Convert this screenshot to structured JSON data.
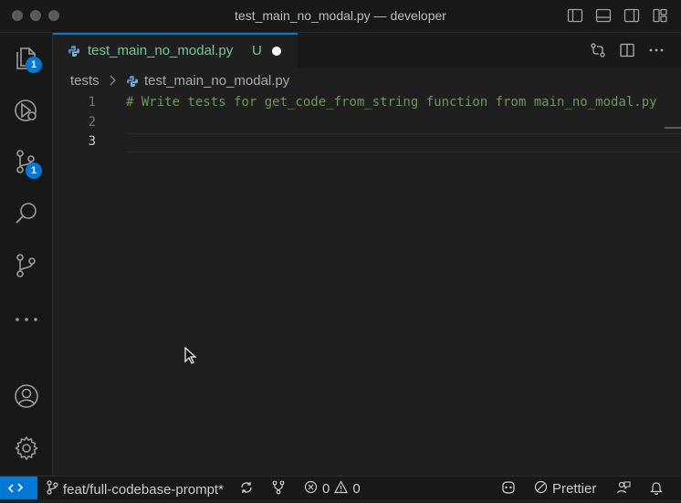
{
  "window": {
    "title": "test_main_no_modal.py — developer"
  },
  "activity_bar": {
    "explorer_badge": "1",
    "source_control_badge": "1"
  },
  "tab": {
    "label": "test_main_no_modal.py",
    "status": "U"
  },
  "breadcrumb": {
    "folder": "tests",
    "file": "test_main_no_modal.py"
  },
  "editor": {
    "lines": [
      {
        "number": "1",
        "text": "# Write tests for get_code_from_string function from main_no_modal.py"
      },
      {
        "number": "2",
        "text": ""
      },
      {
        "number": "3",
        "text": ""
      }
    ],
    "active_line": "3"
  },
  "status_bar": {
    "branch": "feat/full-codebase-prompt*",
    "errors": "0",
    "warnings": "0",
    "formatter": "Prettier"
  },
  "colors": {
    "accent": "#0078d4",
    "untracked_file": "#73c991",
    "comment": "#6a9955"
  }
}
